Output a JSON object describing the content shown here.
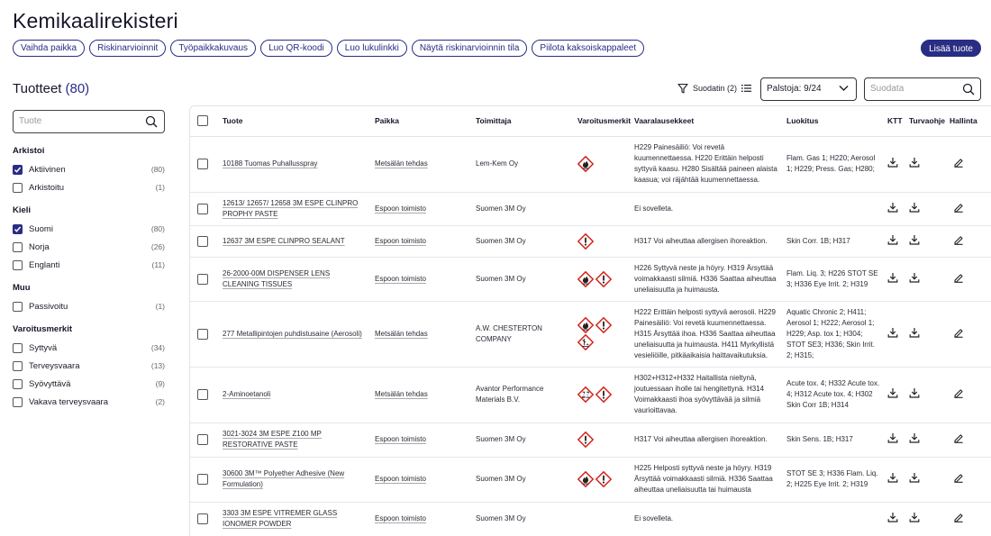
{
  "page": {
    "title": "Kemikaalirekisteri"
  },
  "actions": [
    "Vaihda paikka",
    "Riskinarvioinnit",
    "Työpaikkakuvaus",
    "Luo QR-koodi",
    "Luo lukulinkki",
    "Näytä riskinarvioinnin tila",
    "Piilota kaksoiskappaleet"
  ],
  "add_product": "Lisää tuote",
  "products": {
    "label": "Tuotteet",
    "count": "(80)"
  },
  "toolbar": {
    "filter": "Suodatin (2)",
    "columns": "Palstoja: 9/24",
    "search_placeholder": "Suodata"
  },
  "sidebar": {
    "search_placeholder": "Tuote",
    "groups": [
      {
        "title": "Arkistoi",
        "items": [
          {
            "label": "Aktiivinen",
            "count": "(80)",
            "checked": true
          },
          {
            "label": "Arkistoitu",
            "count": "(1)",
            "checked": false
          }
        ]
      },
      {
        "title": "Kieli",
        "items": [
          {
            "label": "Suomi",
            "count": "(80)",
            "checked": true
          },
          {
            "label": "Norja",
            "count": "(26)",
            "checked": false
          },
          {
            "label": "Englanti",
            "count": "(11)",
            "checked": false
          }
        ]
      },
      {
        "title": "Muu",
        "items": [
          {
            "label": "Passivoitu",
            "count": "(1)",
            "checked": false
          }
        ]
      },
      {
        "title": "Varoitusmerkit",
        "items": [
          {
            "label": "Syttyvä",
            "count": "(34)",
            "checked": false
          },
          {
            "label": "Terveysvaara",
            "count": "(13)",
            "checked": false
          },
          {
            "label": "Syövyttävä",
            "count": "(9)",
            "checked": false
          },
          {
            "label": "Vakava terveysvaara",
            "count": "(2)",
            "checked": false
          }
        ]
      }
    ]
  },
  "table": {
    "columns": [
      "Tuote",
      "Paikka",
      "Toimittaja",
      "Varoitusmerkit",
      "Vaaralausekkeet",
      "Luokitus",
      "KTT",
      "Turvaohje",
      "Hallinta"
    ],
    "rows": [
      {
        "product": "10188 Tuomas Puhallusspray",
        "place": "Metsälän tehdas",
        "supplier": "Lem-Kem Oy",
        "pictograms": [
          "flame"
        ],
        "hazard": "H229 Painesäiliö: Voi revetä kuumennettaessa. H220 Erittäin helposti syttyvä kaasu. H280 Sisältää paineen alaista kaasua; voi räjähtää kuumennettaessa.",
        "classification": "Flam. Gas 1; H220; Aerosol 1; H229; Press. Gas; H280;",
        "h": 62
      },
      {
        "product": "12613/ 12657/ 12658 3M ESPE CLINPRO PROPHY PASTE",
        "place": "Espoon toimisto",
        "supplier": "Suomen 3M Oy",
        "pictograms": [],
        "hazard": "Ei sovelleta.",
        "classification": "",
        "h": 37
      },
      {
        "product": "12637 3M ESPE CLINPRO SEALANT",
        "place": "Espoon toimisto",
        "supplier": "Suomen 3M Oy",
        "pictograms": [
          "exclamation"
        ],
        "hazard": "H317 Voi aiheuttaa allergisen ihoreaktion.",
        "classification": "Skin Corr. 1B; H317",
        "h": 35
      },
      {
        "product": "26-2000-00M DISPENSER LENS CLEANING TISSUES",
        "place": "Espoon toimisto",
        "supplier": "Suomen 3M Oy",
        "pictograms": [
          "flame",
          "exclamation"
        ],
        "hazard": "H226 Syttyvä neste ja höyry. H319 Ärsyttää voimakkaasti silmiä. H336 Saattaa aiheuttaa uneliaisuutta ja huimausta.",
        "classification": "Flam. Liq. 3; H226 STOT SE 3; H336 Eye Irrit. 2; H319",
        "h": 49
      },
      {
        "product": "277 Metallipintojen puhdistusaine (Aerosoli)",
        "place": "Metsälän tehdas",
        "supplier": "A.W. CHESTERTON COMPANY",
        "pictograms": [
          "flame",
          "exclamation",
          "environment"
        ],
        "hazard": "H222 Erittäin helposti syttyvä aerosoli. H229 Painesäiliö: Voi revetä kuumennettaessa. H315 Ärsyttää ihoa. H336 Saattaa aiheuttaa uneliaisuutta ja huimausta. H411 Myrkyllistä vesieliöille, pitkäaikaisia haittavaikutuksia.",
        "classification": "Aquatic Chronic 2; H411; Aerosol 1; H222; Aerosol 1; H229; Asp. tox 1; H304; STOT SE3; H336; Skin Irrit. 2; H315;",
        "h": 73
      },
      {
        "product": "2-Aminoetanoli",
        "place": "Metsälän tehdas",
        "supplier": "Avantor Performance Materials B.V.",
        "pictograms": [
          "corrosive",
          "exclamation"
        ],
        "hazard": "H302+H312+H332 Haitallista nieltynä, joutuessaan iholle tai hengitettynä. H314 Voimakkaasti ihoa syövyttävää ja silmiä vaurioittavaa.",
        "classification": "Acute tox. 4; H332 Acute tox. 4; H312 Acute tox. 4; H302 Skin Corr 1B; H314",
        "h": 62
      },
      {
        "product": "3021-3024 3M ESPE Z100 MP RESTORATIVE PASTE",
        "place": "Espoon toimisto",
        "supplier": "Suomen 3M Oy",
        "pictograms": [
          "exclamation"
        ],
        "hazard": "H317 Voi aiheuttaa allergisen ihoreaktion.",
        "classification": "Skin Sens. 1B; H317",
        "h": 38
      },
      {
        "product": "30600 3M™ Polyether Adhesive (New Formulation)",
        "place": "Espoon toimisto",
        "supplier": "Suomen 3M Oy",
        "pictograms": [
          "flame",
          "exclamation"
        ],
        "hazard": "H225 Helposti syttyvä neste ja höyry. H319 Ärsyttää voimakkaasti silmiä. H336 Saattaa aiheuttaa uneliaisuutta tai huimausta",
        "classification": "STOT SE 3; H336 Flam. Liq. 2; H225 Eye Irrit. 2; H319",
        "h": 50
      },
      {
        "product": "3303 3M ESPE VITREMER GLASS IONOMER POWDER",
        "place": "Espoon toimisto",
        "supplier": "Suomen 3M Oy",
        "pictograms": [],
        "hazard": "Ei sovelleta.",
        "classification": "",
        "h": 38
      }
    ]
  }
}
